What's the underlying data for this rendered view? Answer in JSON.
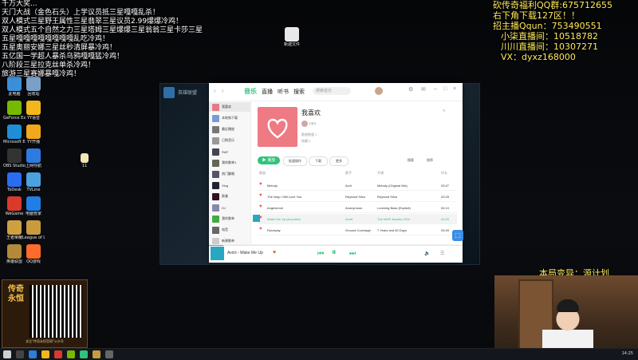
{
  "overlay_left": [
    "千万大奖...",
    "天门大战（金色石头）上学议员抵三星嘎嘎乱杀！",
    "双人模式三星野王属性三星翡翠三星议员2.99爆爆冷鸡！",
    "双人模式五个自然之力三星塔姆三星爆爆三星翁翁三星卡莎三星",
    "五星嘎嘎嘎嘎嘎嘎嘎嘎乱吃冷鸡！",
    "五星奥丽安娜三星丝秒清屏暴冷鸡！",
    "五亿国一学超人暴杀乌鸦嘎嘎猛冷鸡！",
    "八阶段三星拉克丝单杀冷鸡！",
    "旅游三星赛娜暴嘎冷鸡！"
  ],
  "overlay_right": [
    "砍传奇福利QQ群:675712655",
    "右下角下载127区！！",
    "招主播Qqun：753490551",
    "小柒直播间：10518782",
    "川川直播间：10307271",
    "VX：dyxz168000"
  ],
  "cam_label": "本局变异：源计划",
  "desktop_icons": [
    {
      "label": "此电脑",
      "color": "#3b8fd9"
    },
    {
      "label": "回收站",
      "color": "#7aa0c8"
    },
    {
      "label": "GeForce Experience",
      "color": "#76b900"
    },
    {
      "label": "YY语音",
      "color": "#f3b71b"
    },
    {
      "label": "Microsoft Edge",
      "color": "#1e8fd6"
    },
    {
      "label": "YY开播",
      "color": "#f3a81b"
    },
    {
      "label": "OBS Studio",
      "color": "#333"
    },
    {
      "label": "上网导航",
      "color": "#2d7be0"
    },
    {
      "label": "ToDesk",
      "color": "#2b6df0"
    },
    {
      "label": "TVLine",
      "color": "#4aa3df"
    },
    {
      "label": "WeGame",
      "color": "#d93a2b"
    },
    {
      "label": "电脑管家",
      "color": "#1f7fe5"
    },
    {
      "label": "王者荣耀",
      "color": "#d0a040"
    },
    {
      "label": "League of Legends",
      "color": "#c89b3c"
    },
    {
      "label": "英雄联盟",
      "color": "#b5893a"
    },
    {
      "label": "QQ游戏",
      "color": "#ff6b2b"
    }
  ],
  "desktop_file": {
    "label": "新建文件"
  },
  "desktop_file2": {
    "label": "11"
  },
  "game_window": {
    "title": "英雄联盟"
  },
  "music": {
    "nav": [
      "音乐",
      "直播",
      "听书",
      "搜索"
    ],
    "search_placeholder": "搜索音乐",
    "sidebar": [
      {
        "label": "我喜欢",
        "color": "#e47b86"
      },
      {
        "label": "本地和下载",
        "color": "#7a9ad6"
      },
      {
        "label": "最近播放",
        "color": "#777"
      },
      {
        "label": "已购音乐",
        "color": "#999"
      },
      {
        "label": "RAP",
        "color": "#445"
      },
      {
        "label": "我的歌单1",
        "color": "#665"
      },
      {
        "label": "热门翻唱",
        "color": "#556"
      },
      {
        "label": "Vlog",
        "color": "#223"
      },
      {
        "label": "欧美",
        "color": "#312"
      },
      {
        "label": "DJ",
        "color": "#88a"
      },
      {
        "label": "我的歌单",
        "color": "#4a4"
      },
      {
        "label": "电音",
        "color": "#666"
      },
      {
        "label": "新建歌单",
        "color": "#ccc"
      }
    ],
    "playlist": {
      "title": "我喜欢",
      "user": "川川",
      "meta1": "歌曲数量 1",
      "meta2": "收藏 0"
    },
    "actions": {
      "play": "播放",
      "batch": "批量操作",
      "download": "下载",
      "more": "更多"
    },
    "right_actions": {
      "search": "搜索",
      "sort": "排序"
    },
    "columns": {
      "title": "歌曲",
      "artist": "歌手",
      "album": "专辑",
      "time": "时长"
    },
    "songs": [
      {
        "title": "Melody",
        "artist": "Avril",
        "album": "Melody (Original Mix)",
        "time": "03:47"
      },
      {
        "title": "The Way I Still Love You",
        "artist": "Reynard Silva",
        "album": "Reynard Silva",
        "time": "03:25"
      },
      {
        "title": "Angelsmoe",
        "artist": "Anonymous",
        "album": "Looming Bass (Explicit)",
        "time": "04:10"
      },
      {
        "title": "Wake Me Up (Acoustic)",
        "artist": "Avicii",
        "album": "The MMF Awards 2014",
        "time": "04:09"
      },
      {
        "title": "Runaway",
        "artist": "Ground Coverage",
        "album": "7 Years and 50 Days",
        "time": "03:49"
      }
    ],
    "now_playing": "Avicii - Wake Me Up"
  },
  "promo": {
    "brand": "传奇永恒",
    "footer": "关注\"传奇永恒官网\"公众号"
  },
  "taskbar": {
    "clock": "14:25"
  }
}
